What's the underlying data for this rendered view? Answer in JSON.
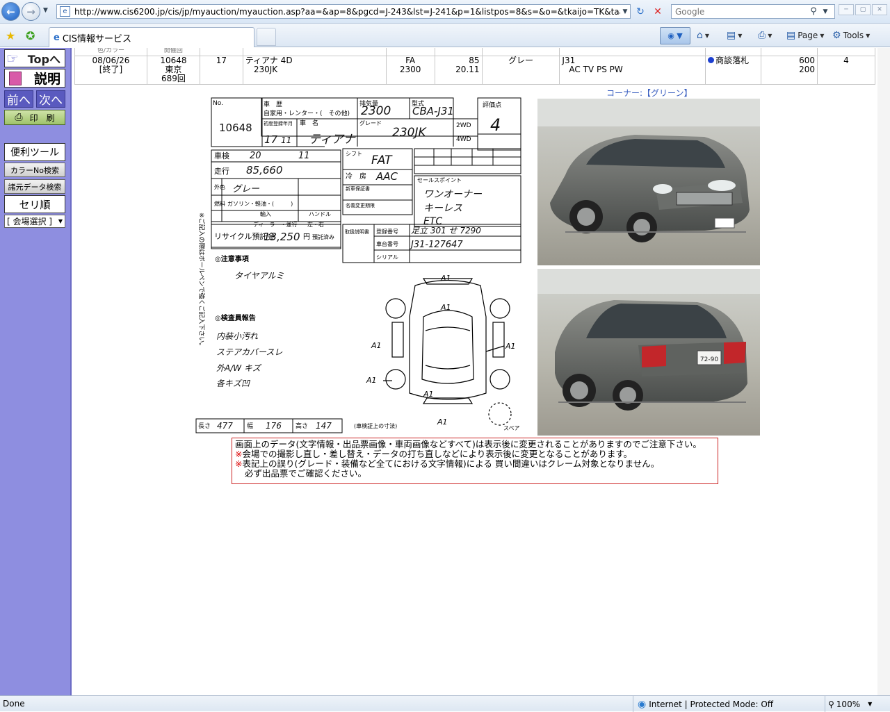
{
  "browser": {
    "url": "http://www.cis6200.jp/cis/jp/myauction/myauction.asp?aa=&ap=8&pgcd=J-243&lst=J-241&p=1&listpos=8&s=&o=&tkaijo=TK&taa=689&tsyup=",
    "search_placeholder": "Google",
    "tab_title": "CIS情報サービス",
    "page_label": "Page",
    "tools_label": "Tools",
    "status_text": "Done",
    "zone_text": "Internet | Protected Mode: Off",
    "zoom_text": "100%"
  },
  "sidebar": {
    "top_label": "Topへ",
    "help_label": "説明",
    "prev_label": "前へ",
    "next_label": "次へ",
    "print_label": "印　刷",
    "tools_label": "便利ツール",
    "color_search_label": "カラーNo検索",
    "spec_search_label": "諸元データ検索",
    "seri_label": "セリ順",
    "venue_select_label": "[ 会場選択 ]"
  },
  "row": {
    "hdr1": "色/カラー",
    "hdr2": "開催回",
    "date": "08/06/26",
    "status": "[終了]",
    "lot": "10648",
    "venue": "東京",
    "session": "689回",
    "count": "17",
    "model": "ティアナ 4D",
    "grade": "230JK",
    "shift": "FA",
    "cc": "2300",
    "mileage_upper": "85",
    "mileage_lower": "20.11",
    "color": "グレー",
    "chassis": "J31",
    "options": "AC TV PS PW",
    "result": "商談落札",
    "price1": "600",
    "price2": "200",
    "score": "4"
  },
  "sheet": {
    "lot_number": "10648",
    "model": "ティアナ",
    "grade": "230JK",
    "displacement": "2300",
    "model_code": "CBA-J31",
    "score": "4",
    "year": "17",
    "month": "11",
    "inspection_year": "20",
    "inspection_month": "11",
    "mileage": "85,660",
    "shift": "FAT",
    "aircon": "AAC",
    "color": "グレー",
    "recycle_fee": "13,250",
    "chassis_no": "J31-127647",
    "plate": "足立 301 せ 7290",
    "length": "477",
    "width": "176",
    "height": "147",
    "sales_points": [
      "ワンオーナー",
      "キーレス",
      "ETC"
    ],
    "notes_title": "◎注意事項",
    "notes": [
      "タイヤアルミ"
    ],
    "inspector_title": "◎検査員報告",
    "inspector_notes": [
      "内装小汚れ",
      "ステアカバースレ",
      "外A/W キズ",
      "各キズ凹"
    ],
    "labels": {
      "history": "車　歴",
      "displacement": "排気量",
      "type": "型式",
      "score": "評価点",
      "first_reg": "初度登録年月",
      "name": "車　名",
      "grade": "グレード",
      "inspection": "車検",
      "mileage": "走行",
      "shift": "シフト",
      "ac": "冷　房",
      "exterior_color": "外色",
      "sales_point": "セールスポイント",
      "recycle": "リサイクル預託金",
      "yen": "円",
      "deposit": "預託済み",
      "length": "長さ",
      "width": "幅",
      "height": "高さ",
      "dims_note": "(車検証上の寸法)",
      "spare": "スペア",
      "side_note": "※ご記入の際はボールペンで強くご記入下さい。",
      "fuel": "燃料",
      "gasoline": "ガソリン・軽油・(　　　)",
      "import": "輸入",
      "dealer": "ディーラー・並行",
      "handle": "ハンドル",
      "lr": "左・右",
      "new_cert": "新車保証書",
      "manual": "取扱説明書",
      "regdate": "登録番号",
      "chassisnum": "車台番号",
      "serial": "シリアル",
      "dealer_changes": "名義変更期限",
      "rental": "自家用・レンター・(　その他)"
    },
    "damage_codes": [
      "A1",
      "A1",
      "A1",
      "A1",
      "A1",
      "A1",
      "A1"
    ]
  },
  "corner_label": "コーナー:【グリーン】",
  "notice": {
    "line1": "画面上のデータ(文字情報・出品票画像・車両画像などすべて)は表示後に変更されることがありますのでご注意下さい。",
    "mark": "※",
    "line2": "会場での撮影し直し・差し替え・データの打ち直しなどにより表示後に変更となることがあります。",
    "line3": "表記上の誤り(グレード・装備など全てにおける文字情報)による 買い間違いはクレーム対象となりません。",
    "line4": "必ず出品票でご確認ください。"
  },
  "plate_rear": "72-90"
}
